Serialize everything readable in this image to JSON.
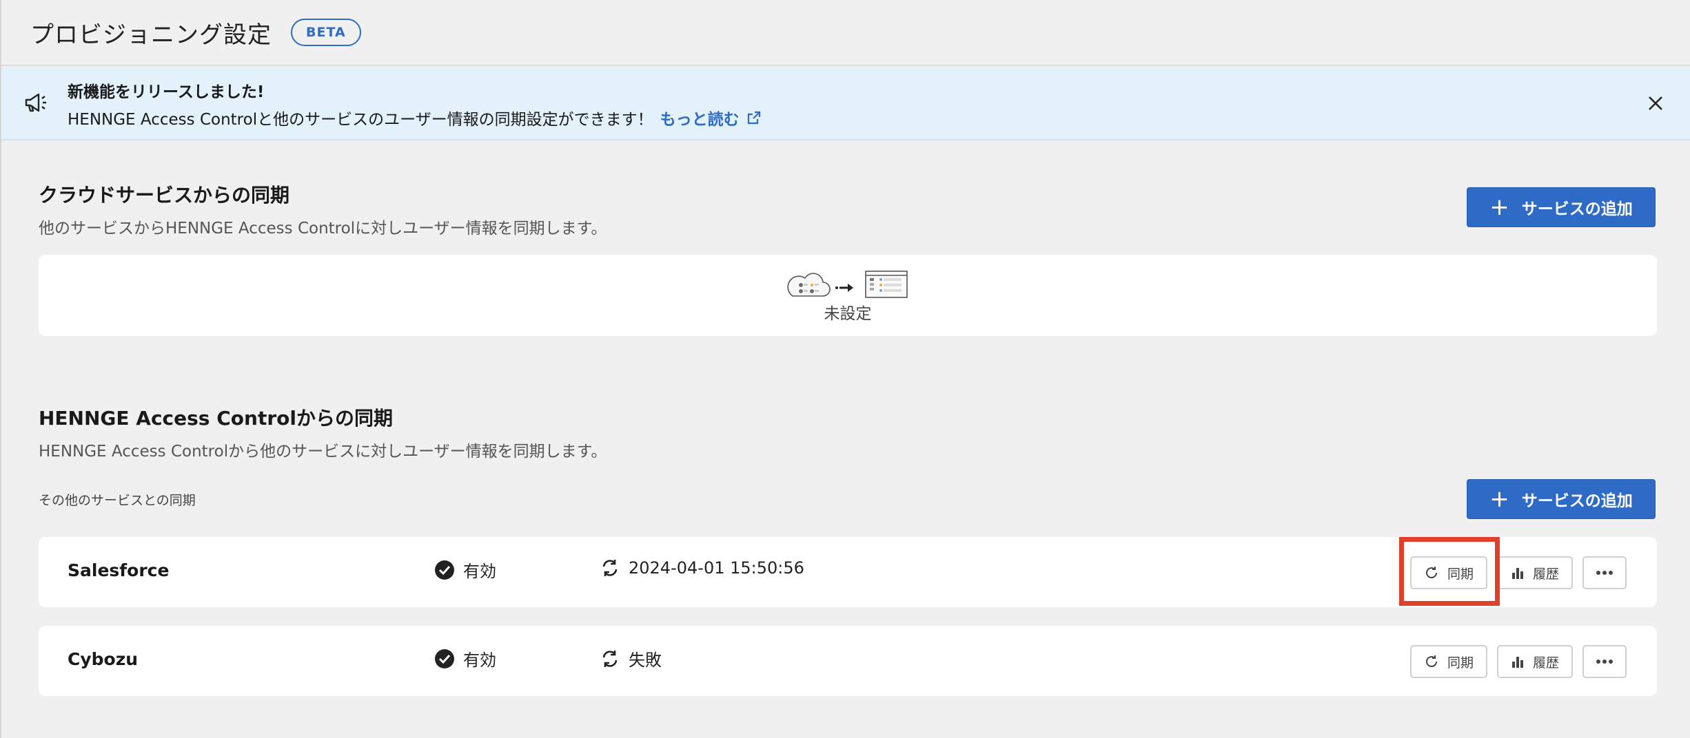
{
  "header": {
    "title": "プロビジョニング設定",
    "badge": "BETA"
  },
  "banner": {
    "heading": "新機能をリリースしました!",
    "text": "HENNGE Access Controlと他のサービスのユーザー情報の同期設定ができます！",
    "link_label": "もっと読む"
  },
  "cloud_section": {
    "heading": "クラウドサービスからの同期",
    "description": "他のサービスからHENNGE Access Controlに対しユーザー情報を同期します。",
    "add_button": "サービスの追加",
    "empty_label": "未設定"
  },
  "hac_section": {
    "heading": "HENNGE Access Controlからの同期",
    "description": "HENNGE Access Controlから他のサービスに対しユーザー情報を同期します。",
    "sub_label": "その他のサービスとの同期",
    "add_button": "サービスの追加",
    "services": [
      {
        "name": "Salesforce",
        "status": "有効",
        "last_sync": "2024-04-01 15:50:56",
        "sync_button": "同期",
        "history_button": "履歴"
      },
      {
        "name": "Cybozu",
        "status": "有効",
        "last_sync": "失敗",
        "sync_button": "同期",
        "history_button": "履歴"
      }
    ]
  },
  "colors": {
    "accent": "#2e6bc6",
    "banner_bg": "#e3f1fb",
    "page_bg": "#f0f0f0",
    "highlight": "#e0402a"
  },
  "icons": {
    "banner": "megaphone-icon",
    "close": "close-icon",
    "external": "external-link-icon",
    "status": "check-circle-icon",
    "sync_status": "sync-icon",
    "sync_button": "refresh-icon",
    "history_button": "bar-chart-icon",
    "more_button": "more-horizontal-icon"
  }
}
